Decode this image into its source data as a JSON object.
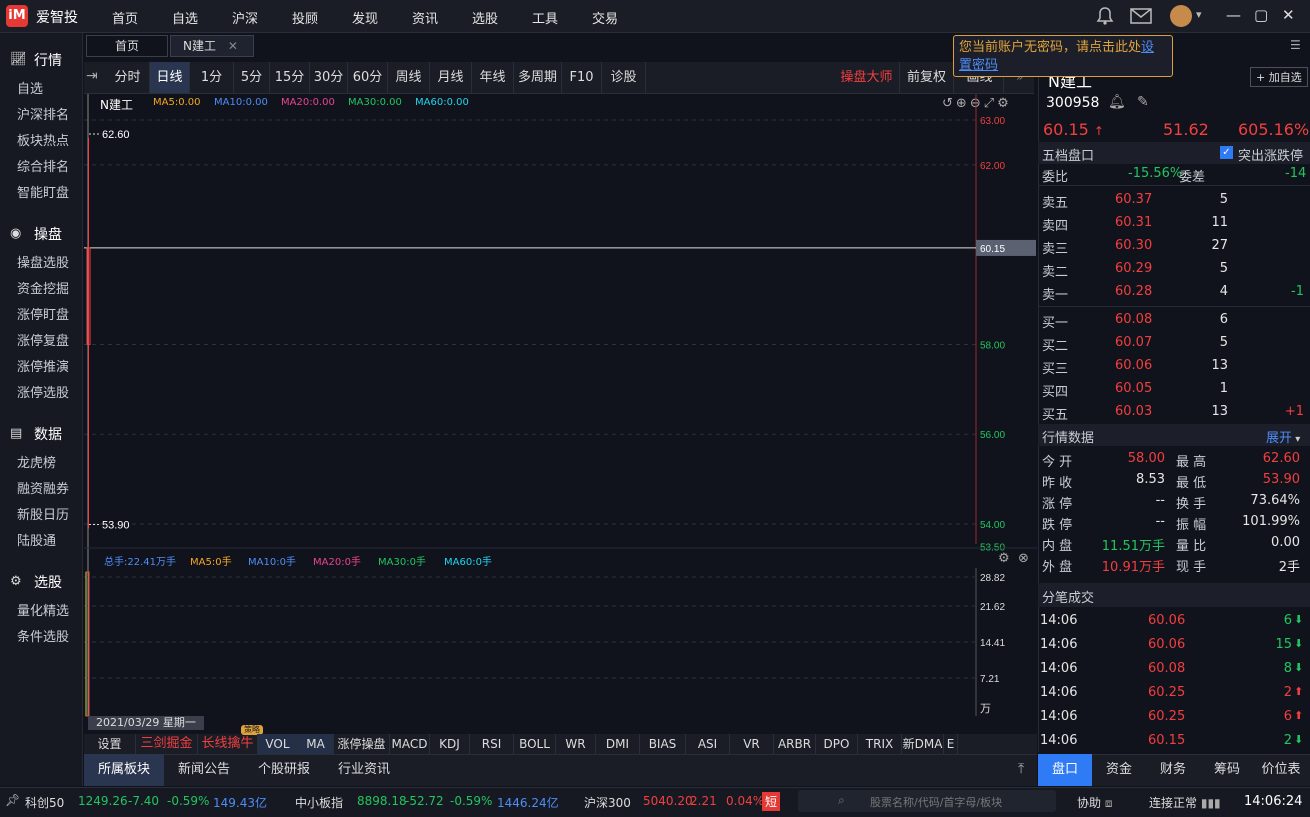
{
  "app": {
    "logo_text": "iM",
    "name": "爱智投"
  },
  "top_nav": [
    "首页",
    "自选",
    "沪深",
    "投顾",
    "发现",
    "资讯",
    "选股",
    "工具",
    "交易"
  ],
  "tabs": [
    {
      "label": "首页"
    },
    {
      "label": "N建工"
    }
  ],
  "tooltip": {
    "text": "您当前账户无密码，请点击此处",
    "link": "设置密码"
  },
  "sidebar": {
    "sections": [
      {
        "title": "行情",
        "items": [
          "自选",
          "沪深排名",
          "板块热点",
          "综合排名",
          "智能盯盘"
        ]
      },
      {
        "title": "操盘",
        "items": [
          "操盘选股",
          "资金挖掘",
          "涨停盯盘",
          "涨停复盘",
          "涨停推演",
          "涨停选股"
        ]
      },
      {
        "title": "数据",
        "items": [
          "龙虎榜",
          "融资融券",
          "新股日历",
          "陆股通"
        ]
      },
      {
        "title": "选股",
        "items": [
          "量化精选",
          "条件选股"
        ]
      }
    ]
  },
  "periods": [
    "分时",
    "日线",
    "1分",
    "5分",
    "15分",
    "30分",
    "60分",
    "周线",
    "月线",
    "年线",
    "多周期",
    "F10",
    "诊股"
  ],
  "period_right": {
    "master": "操盘大师",
    "adjust": "前复权",
    "next": "画线"
  },
  "chart_header": {
    "name": "N建工",
    "ma5": "MA5:0.00",
    "ma10": "MA10:0.00",
    "ma20": "MA20:0.00",
    "ma30": "MA30:0.00",
    "ma60": "MA60:0.00"
  },
  "chart_data": {
    "type": "candlestick",
    "price_ticks": [
      "63.00",
      "62.00",
      "60.15",
      "58.00",
      "56.00",
      "54.00",
      "53.50"
    ],
    "high_label": "62.60",
    "low_label": "53.90",
    "current_label": "60.15",
    "candle": {
      "open": 58.0,
      "high": 62.6,
      "low": 53.9,
      "close": 60.15
    },
    "vol_ticks": [
      "28.82",
      "21.62",
      "14.41",
      "7.21",
      "万"
    ],
    "date_label": "2021/03/29 星期一"
  },
  "vol_header": {
    "total": "总手:22.41万手",
    "ma5": "MA5:0手",
    "ma10": "MA10:0手",
    "ma20": "MA20:0手",
    "ma30": "MA30:0手",
    "ma60": "MA60:0手"
  },
  "stock": {
    "name": "N建工",
    "code": "300958",
    "add_btn": "+ 加自选",
    "price": "60.15",
    "change": "51.62",
    "pct": "605.16%"
  },
  "orderbook": {
    "title": "五档盘口",
    "highlight": "突出涨跌停",
    "weibi_label": "委比",
    "weibi": "-15.56%",
    "weicha_label": "委差",
    "weicha": "-14",
    "asks": [
      [
        "卖五",
        "60.37",
        "5",
        ""
      ],
      [
        "卖四",
        "60.31",
        "11",
        ""
      ],
      [
        "卖三",
        "60.30",
        "27",
        ""
      ],
      [
        "卖二",
        "60.29",
        "5",
        ""
      ],
      [
        "卖一",
        "60.28",
        "4",
        "-1"
      ]
    ],
    "bids": [
      [
        "买一",
        "60.08",
        "6",
        ""
      ],
      [
        "买二",
        "60.07",
        "5",
        ""
      ],
      [
        "买三",
        "60.06",
        "13",
        ""
      ],
      [
        "买四",
        "60.05",
        "1",
        ""
      ],
      [
        "买五",
        "60.03",
        "13",
        "+1"
      ]
    ]
  },
  "market": {
    "title": "行情数据",
    "expand": "展开",
    "rows": [
      [
        "今 开",
        "58.00",
        "最 高",
        "62.60"
      ],
      [
        "昨 收",
        "8.53",
        "最 低",
        "53.90"
      ],
      [
        "涨 停",
        "--",
        "换 手",
        "73.64%"
      ],
      [
        "跌 停",
        "--",
        "振 幅",
        "101.99%"
      ],
      [
        "内 盘",
        "11.51万手",
        "量 比",
        "0.00"
      ],
      [
        "外 盘",
        "10.91万手",
        "现 手",
        "2手"
      ]
    ]
  },
  "ticks": {
    "title": "分笔成交",
    "rows": [
      [
        "14:06",
        "60.06",
        "6"
      ],
      [
        "14:06",
        "60.06",
        "15"
      ],
      [
        "14:06",
        "60.08",
        "8"
      ],
      [
        "14:06",
        "60.25",
        "2"
      ],
      [
        "14:06",
        "60.25",
        "6"
      ],
      [
        "14:06",
        "60.15",
        "2"
      ]
    ]
  },
  "indicators": [
    "设置",
    "三剑掘金",
    "长线擒牛",
    "VOL",
    "MA",
    "涨停操盘",
    "MACD",
    "KDJ",
    "RSI",
    "BOLL",
    "WR",
    "DMI",
    "BIAS",
    "ASI",
    "VR",
    "ARBR",
    "DPO",
    "TRIX",
    "新DMA",
    "E"
  ],
  "indicator_badge": "策略",
  "bottom_tabs": [
    "所属板块",
    "新闻公告",
    "个股研报",
    "行业资讯"
  ],
  "right_tabs": [
    "盘口",
    "资金",
    "财务",
    "筹码",
    "价位表"
  ],
  "status": {
    "idx1": [
      "科创50",
      "1249.26",
      "-7.40",
      "-0.59%",
      "149.43亿"
    ],
    "idx2": [
      "中小板指",
      "8898.18",
      "-52.72",
      "-0.59%",
      "1446.24亿"
    ],
    "idx3": [
      "沪深300",
      "5040.20",
      "2.21",
      "0.04%"
    ],
    "short": "短",
    "search_placeholder": "股票名称/代码/首字母/板块",
    "assist": "协助",
    "conn": "连接正常",
    "time": "14:06:24"
  }
}
